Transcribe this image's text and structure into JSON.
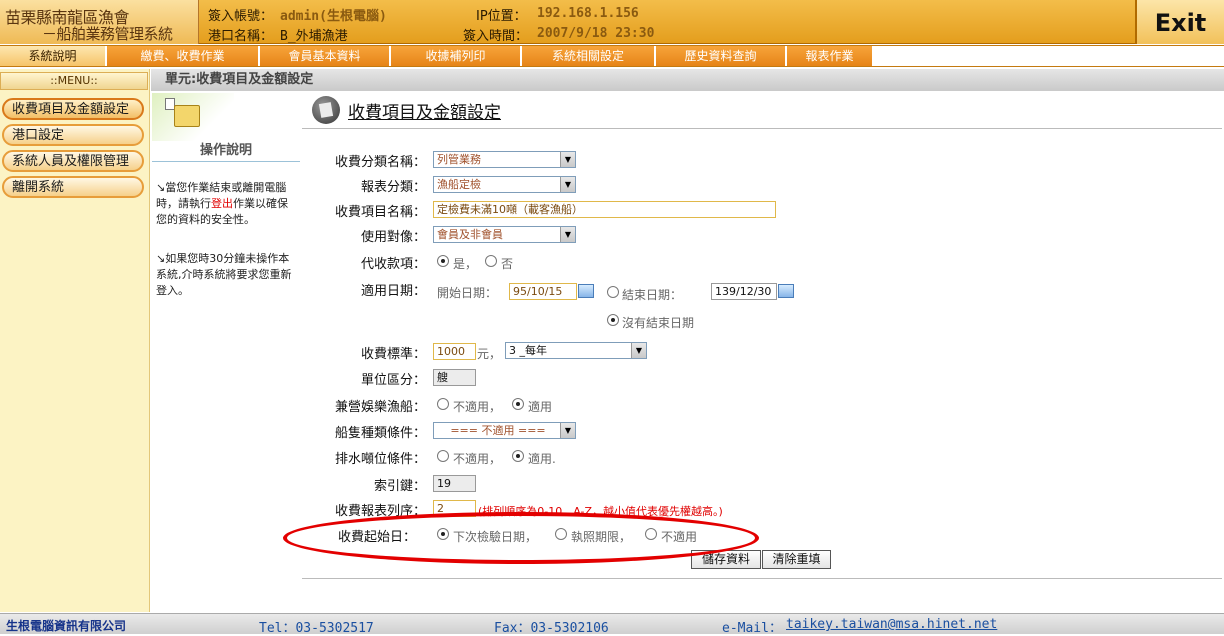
{
  "header": {
    "brand_line1": "苗栗縣南龍區漁會",
    "brand_line2": "－船舶業務管理系統",
    "account_label": "簽入帳號：",
    "account_value": "admin(生根電腦)",
    "port_label": "港口名稱：",
    "port_value": "B_外埔漁港",
    "ip_label": "IP位置：",
    "ip_value": "192.168.1.156",
    "login_label": "簽入時間：",
    "login_value": "2007/9/18 23:30",
    "exit_label": "Exit"
  },
  "topnav": {
    "tabs": [
      "系統說明",
      "繳費、收費作業",
      "會員基本資料",
      "收據補列印",
      "系統相關設定",
      "歷史資料查詢",
      "報表作業"
    ]
  },
  "menu": {
    "title": "::MENU::",
    "items": [
      "收費項目及金額設定",
      "港口設定",
      "系統人員及權限管理",
      "離開系統"
    ]
  },
  "breadcrumb": "單元:收費項目及金額設定",
  "help": {
    "title": "操作說明",
    "p1_a": "↘當您作業結束或離開電腦時，請執行",
    "p1_red": "登出",
    "p1_b": "作業以確保您的資料的安全性。",
    "p2": "↘如果您時30分鐘未操作本系統,介時系統將要求您重新登入。"
  },
  "form": {
    "title": "收費項目及金額設定",
    "category_label": "收費分類名稱：",
    "category_value": "列管業務",
    "report_label": "報表分類：",
    "report_value": "漁船定檢",
    "item_label": "收費項目名稱：",
    "item_value": "定檢費未滿10噸（載客漁船）",
    "target_label": "使用對像：",
    "target_value": "會員及非會員",
    "collect_label": "代收款項：",
    "collect_yes": "是，",
    "collect_no": "否",
    "date_label": "適用日期：",
    "start_label": "開始日期：",
    "start_value": "95/10/15",
    "end_label": "結束日期：",
    "end_value": "139/12/30",
    "no_end_label": "沒有結束日期",
    "standard_label": "收費標準：",
    "standard_value": "1000",
    "standard_unit": "元，",
    "period_value": "3 _每年",
    "unit_label": "單位區分：",
    "unit_value": "艘",
    "leisure_label": "兼營娛樂漁船：",
    "leisure_no": "不適用，",
    "leisure_yes": "適用",
    "vessel_label": "船隻種類條件：",
    "vessel_value": "=== 不適用 ===",
    "tonnage_label": "排水噸位條件：",
    "tonnage_no": "不適用，",
    "tonnage_yes": "適用.",
    "index_label": "索引鍵：",
    "index_value": "19",
    "order_label": "收費報表列序：",
    "order_value": "2",
    "order_note": "(排列順序為0-10、A-Z，越小值代表優先權越高。)",
    "startday_label": "收費起始日：",
    "startday_opt1": "下次檢驗日期，",
    "startday_opt2": "執照期限，",
    "startday_opt3": "不適用",
    "save_label": "儲存資料",
    "reset_label": "清除重填"
  },
  "footer": {
    "company": "生根電腦資訊有限公司",
    "tel": "Tel：03-5302517",
    "fax": "Fax：03-5302106",
    "email_label": "e-Mail：",
    "email": "taikey.taiwan@msa.hinet.net"
  }
}
